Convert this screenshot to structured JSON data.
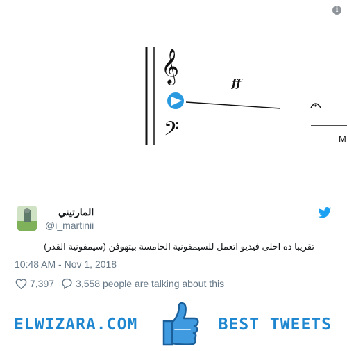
{
  "media": {
    "dynamic_marking": "ff",
    "cut_off_text": "M",
    "info_icon": "info-icon"
  },
  "tweet": {
    "display_name": "المارتيني",
    "handle": "@i_martinii",
    "text": "تقريبا ده احلى فيديو اتعمل للسيمفونية الخامسة بيتهوفن (سيمفونية القدر)",
    "timestamp": "10:48 AM - Nov 1, 2018",
    "likes": "7,397",
    "talking": "3,558 people are talking about this",
    "bird_icon": "twitter-bird-icon"
  },
  "banner": {
    "left_text": "ELWIZARA.COM",
    "right_text": "BEST TWEETS",
    "accent": "#1f87d0"
  }
}
